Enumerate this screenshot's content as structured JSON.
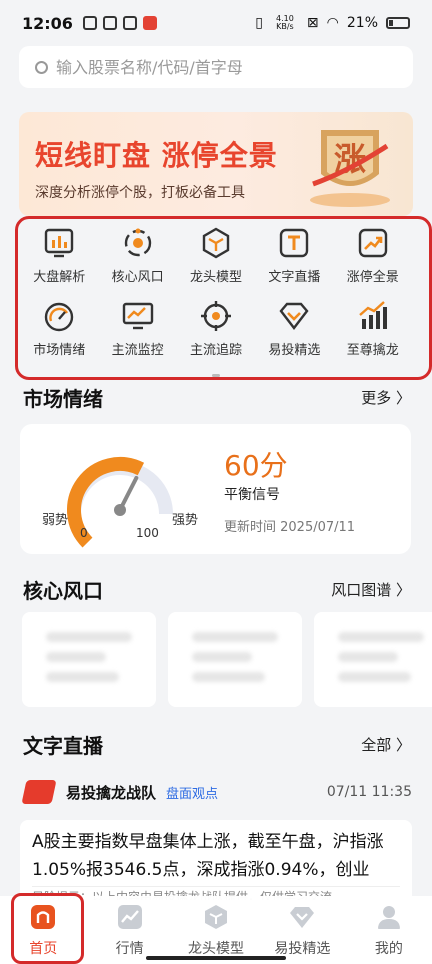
{
  "status": {
    "time": "12:06",
    "net": "4.10 KB/s",
    "battery": "21%"
  },
  "search": {
    "placeholder": "输入股票名称/代码/首字母"
  },
  "banner": {
    "title": "短线盯盘 涨停全景",
    "subtitle": "深度分析涨停个股，打板必备工具",
    "badge": "涨"
  },
  "grid": {
    "items": [
      {
        "label": "大盘解析",
        "icon": "bar-chart-icon"
      },
      {
        "label": "核心风口",
        "icon": "orbit-icon"
      },
      {
        "label": "龙头模型",
        "icon": "cube-icon"
      },
      {
        "label": "文字直播",
        "icon": "text-t-icon"
      },
      {
        "label": "涨停全景",
        "icon": "trend-up-icon"
      },
      {
        "label": "市场情绪",
        "icon": "gauge-icon"
      },
      {
        "label": "主流监控",
        "icon": "monitor-icon"
      },
      {
        "label": "主流追踪",
        "icon": "target-icon"
      },
      {
        "label": "易投精选",
        "icon": "diamond-icon"
      },
      {
        "label": "至尊擒龙",
        "icon": "growth-bars-icon"
      }
    ]
  },
  "mood": {
    "title": "市场情绪",
    "more": "更多 〉",
    "score": "60分",
    "signal": "平衡信号",
    "update": "更新时间 2025/07/11",
    "weak": "弱势",
    "strong": "强势",
    "min": "0",
    "max": "100",
    "value": 60
  },
  "wind": {
    "title": "核心风口",
    "more": "风口图谱 〉"
  },
  "live": {
    "title": "文字直播",
    "more": "全部 〉",
    "source": "易投擒龙战队",
    "tag": "盘面观点",
    "time": "07/11 11:35",
    "text": "A股主要指数早盘集体上涨，截至午盘，沪指涨1.05%报3546.5点，深成指涨0.94%，创业",
    "disclaimer": "风险提示：以上内容由易投擒龙战队提供，仅供学习交流"
  },
  "tabs": [
    {
      "label": "首页",
      "icon": "home-icon"
    },
    {
      "label": "行情",
      "icon": "chart-icon"
    },
    {
      "label": "龙头模型",
      "icon": "cube-icon"
    },
    {
      "label": "易投精选",
      "icon": "diamond-icon"
    },
    {
      "label": "我的",
      "icon": "user-icon"
    }
  ],
  "colors": {
    "accent": "#e8452d",
    "orange": "#f08a1e",
    "highlight_box": "#d42a2a",
    "link": "#2d6be3"
  }
}
